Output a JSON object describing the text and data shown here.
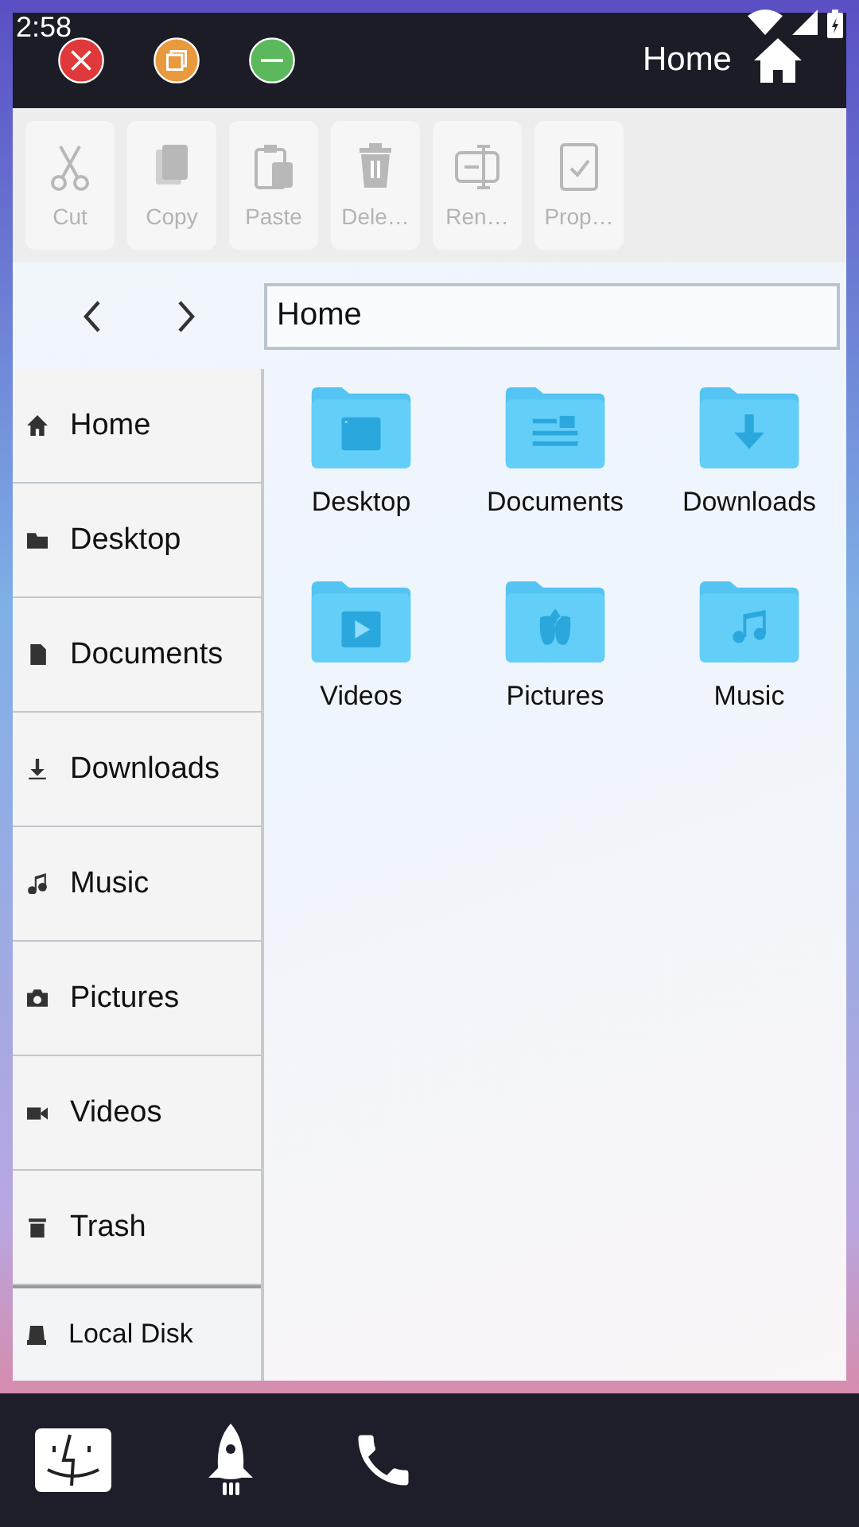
{
  "status_bar": {
    "time": "2:58"
  },
  "window": {
    "title": "Home"
  },
  "toolbar": [
    {
      "label": "Cut",
      "disabled": true
    },
    {
      "label": "Copy",
      "disabled": true
    },
    {
      "label": "Paste",
      "disabled": true
    },
    {
      "label": "Dele…",
      "disabled": true
    },
    {
      "label": "Ren…",
      "disabled": true
    },
    {
      "label": "Prop…",
      "disabled": true
    }
  ],
  "address_bar": {
    "value": "Home"
  },
  "sidebar": {
    "items": [
      {
        "label": "Home"
      },
      {
        "label": "Desktop"
      },
      {
        "label": "Documents"
      },
      {
        "label": "Downloads"
      },
      {
        "label": "Music"
      },
      {
        "label": "Pictures"
      },
      {
        "label": "Videos"
      },
      {
        "label": "Trash"
      }
    ],
    "footer": {
      "label": "Local Disk"
    }
  },
  "folders": [
    {
      "label": "Desktop"
    },
    {
      "label": "Documents"
    },
    {
      "label": "Downloads"
    },
    {
      "label": "Videos"
    },
    {
      "label": "Pictures"
    },
    {
      "label": "Music"
    }
  ]
}
